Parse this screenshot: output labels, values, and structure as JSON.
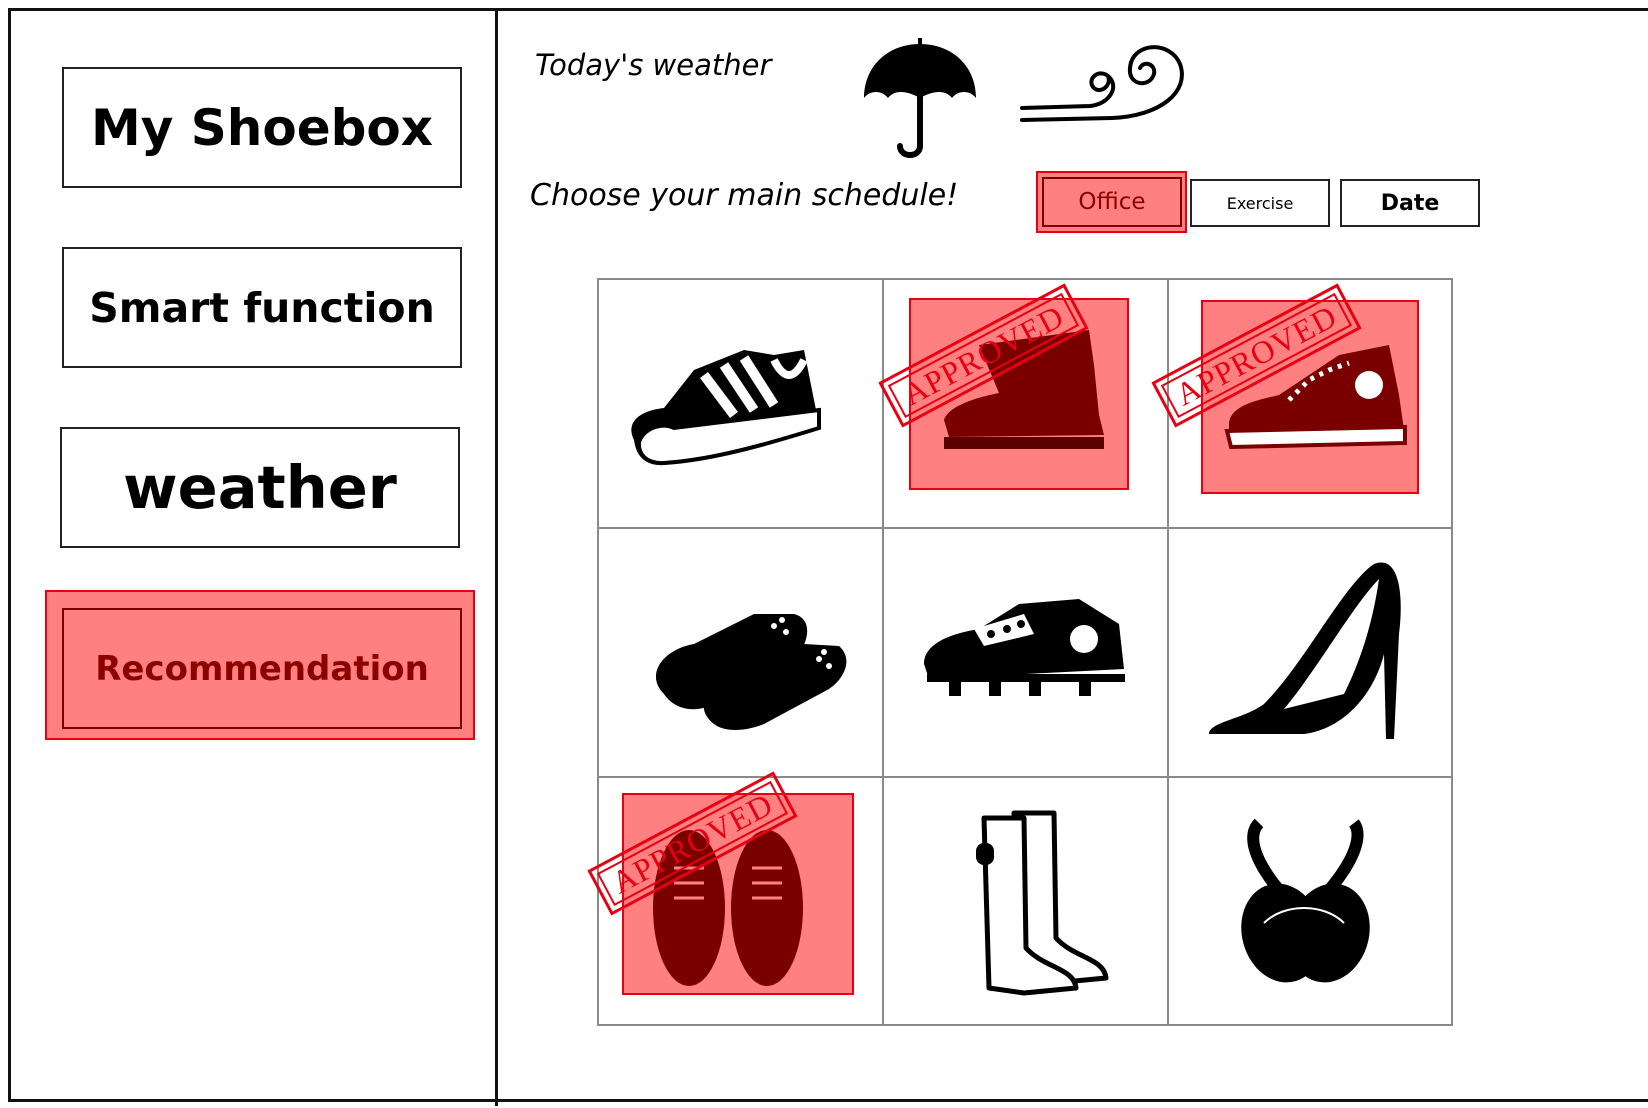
{
  "sidebar": {
    "items": [
      {
        "label": "My Shoebox"
      },
      {
        "label": "Smart function"
      },
      {
        "label": "weather"
      },
      {
        "label": "Recommendation",
        "active": true
      }
    ]
  },
  "main": {
    "weather_label": "Today's weather",
    "weather_icons": [
      "umbrella-icon",
      "wind-icon"
    ],
    "schedule_prompt": "Choose your main schedule!",
    "schedule_options": [
      {
        "label": "Office",
        "selected": true
      },
      {
        "label": "Exercise",
        "selected": false
      },
      {
        "label": "Date",
        "selected": false
      }
    ],
    "stamp_text": "APPROVED",
    "shoes": [
      {
        "name": "sneaker",
        "approved": false
      },
      {
        "name": "work-boot",
        "approved": true
      },
      {
        "name": "high-top-sneaker",
        "approved": true
      },
      {
        "name": "slippers",
        "approved": false
      },
      {
        "name": "soccer-cleat",
        "approved": false
      },
      {
        "name": "high-heel",
        "approved": false
      },
      {
        "name": "oxford-shoes",
        "approved": true
      },
      {
        "name": "rain-boots",
        "approved": false
      },
      {
        "name": "ballet-flats",
        "approved": false
      }
    ]
  },
  "colors": {
    "highlight": "#ff8080",
    "highlight_border": "#e60012",
    "text_dark_red": "#8b0000"
  }
}
